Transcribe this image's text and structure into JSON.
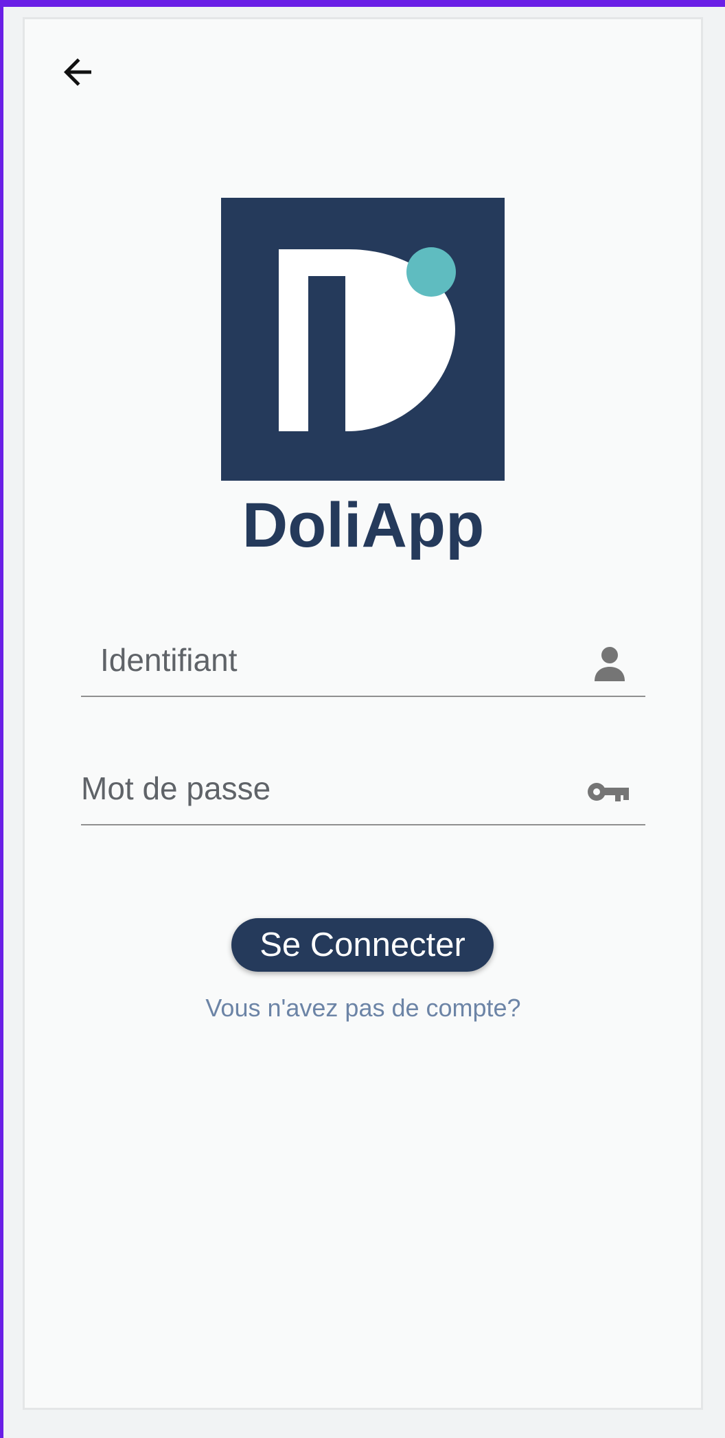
{
  "colors": {
    "brand": "#253a5b",
    "accent": "#5fbcc0",
    "frame": "#6a1fe6",
    "field_text": "#5f6368",
    "link": "#6c84a6"
  },
  "header": {
    "back_icon": "arrow-left-icon"
  },
  "logo": {
    "icon": "doliapp-logo"
  },
  "app": {
    "title": "DoliApp"
  },
  "form": {
    "username": {
      "placeholder": "Identifiant",
      "value": "",
      "icon": "person-icon"
    },
    "password": {
      "placeholder": "Mot de passe",
      "value": "",
      "icon": "key-icon"
    },
    "login_label": "Se Connecter",
    "signup_link": "Vous n'avez pas de compte?"
  }
}
